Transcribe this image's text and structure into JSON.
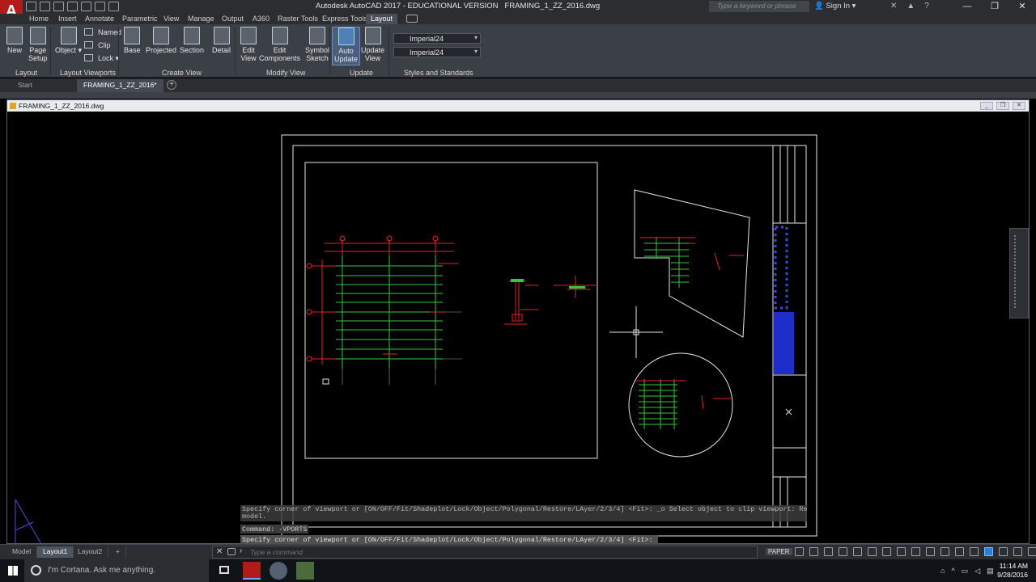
{
  "window": {
    "title": "Autodesk AutoCAD 2017 - EDUCATIONAL VERSION",
    "file": "FRAMING_1_ZZ_2016.dwg",
    "search_placeholder": "Type a keyword or phrase",
    "signin": "Sign In",
    "app_letter": "A"
  },
  "ribbon_tabs": [
    "Home",
    "Insert",
    "Annotate",
    "Parametric",
    "View",
    "Manage",
    "Output",
    "A360",
    "Raster Tools",
    "Express Tools",
    "Layout"
  ],
  "active_tab": "Layout",
  "ribbon": {
    "layout_group": {
      "new": "New",
      "page_setup_1": "Page",
      "page_setup_2": "Setup",
      "label": "Layout"
    },
    "viewports_group": {
      "object": "Object",
      "named": "Named",
      "clip": "Clip",
      "lock": "Lock",
      "label": "Layout Viewports"
    },
    "create_view_group": {
      "base": "Base",
      "projected": "Projected",
      "section": "Section",
      "detail": "Detail",
      "label": "Create View"
    },
    "modify_view_group": {
      "edit_view_1": "Edit",
      "edit_view_2": "View",
      "edit_comp_1": "Edit",
      "edit_comp_2": "Components",
      "symbol_1": "Symbol",
      "symbol_2": "Sketch",
      "label": "Modify View"
    },
    "update_group": {
      "auto_1": "Auto",
      "auto_2": "Update",
      "upd_1": "Update",
      "upd_2": "View",
      "label": "Update"
    },
    "styles_group": {
      "style1": "Imperial24",
      "style2": "Imperial24",
      "label": "Styles and Standards"
    }
  },
  "file_tabs": {
    "start": "Start",
    "active": "FRAMING_1_ZZ_2016*"
  },
  "drawing_window_title": "FRAMING_1_ZZ_2016.dwg",
  "command": {
    "history1": "Specify corner of viewport or [ON/OFF/Fit/Shadeplot/Lock/Object/Polygonal/Restore/LAyer/2/3/4] <Fit>: _o Select object to clip viewport: Regenerating",
    "history2": "model.",
    "line2": "Command: -VPORTS",
    "line3": "Specify corner of viewport or [ON/OFF/Fit/Shadeplot/Lock/Object/Polygonal/Restore/LAyer/2/3/4] <Fit>: *Cancel*",
    "input_placeholder": "Type a command"
  },
  "layout_tabs": [
    "Model",
    "Layout1",
    "Layout2"
  ],
  "active_layout": "Layout1",
  "status": {
    "paper": "PAPER"
  },
  "taskbar": {
    "cortana": "I'm Cortana. Ask me anything.",
    "time": "11:14 AM",
    "date": "9/28/2016"
  },
  "colors": {
    "drawing_green": "#35c83a",
    "drawing_red": "#e02525",
    "titleblock_blue": "#1e2ec9"
  }
}
